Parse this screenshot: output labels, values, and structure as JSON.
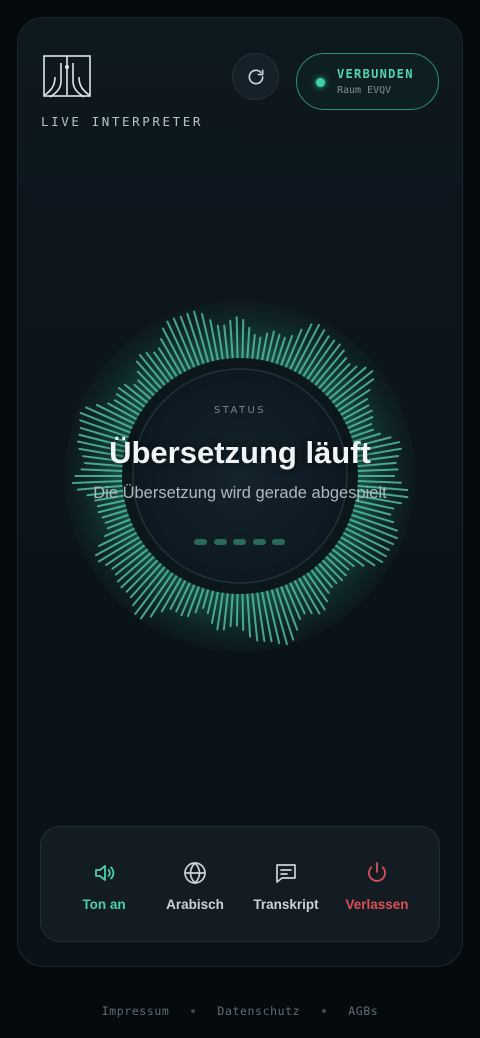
{
  "brand": {
    "name": "LIVE INTERPRETER"
  },
  "header": {
    "refresh_icon": "refresh-icon",
    "connection": {
      "status": "VERBUNDEN",
      "room": "Raum EVQV",
      "color": "#3fd1a6"
    }
  },
  "status": {
    "label": "STATUS",
    "title": "Übersetzung läuft",
    "subtitle": "Die Übersetzung wird gerade abgespielt"
  },
  "controls": [
    {
      "label": "Ton an",
      "icon": "speaker-icon",
      "color": "#49d1ab"
    },
    {
      "label": "Arabisch",
      "icon": "globe-icon",
      "color": "#c9d3d8"
    },
    {
      "label": "Transkript",
      "icon": "message-icon",
      "color": "#c9d3d8"
    },
    {
      "label": "Verlassen",
      "icon": "power-icon",
      "color": "#dd4f57"
    }
  ],
  "footer": {
    "links": [
      "Impressum",
      "Datenschutz",
      "AGBs"
    ]
  },
  "colors": {
    "accent": "#3fd1a6",
    "danger": "#dd4f57",
    "background": "#060a0d"
  }
}
